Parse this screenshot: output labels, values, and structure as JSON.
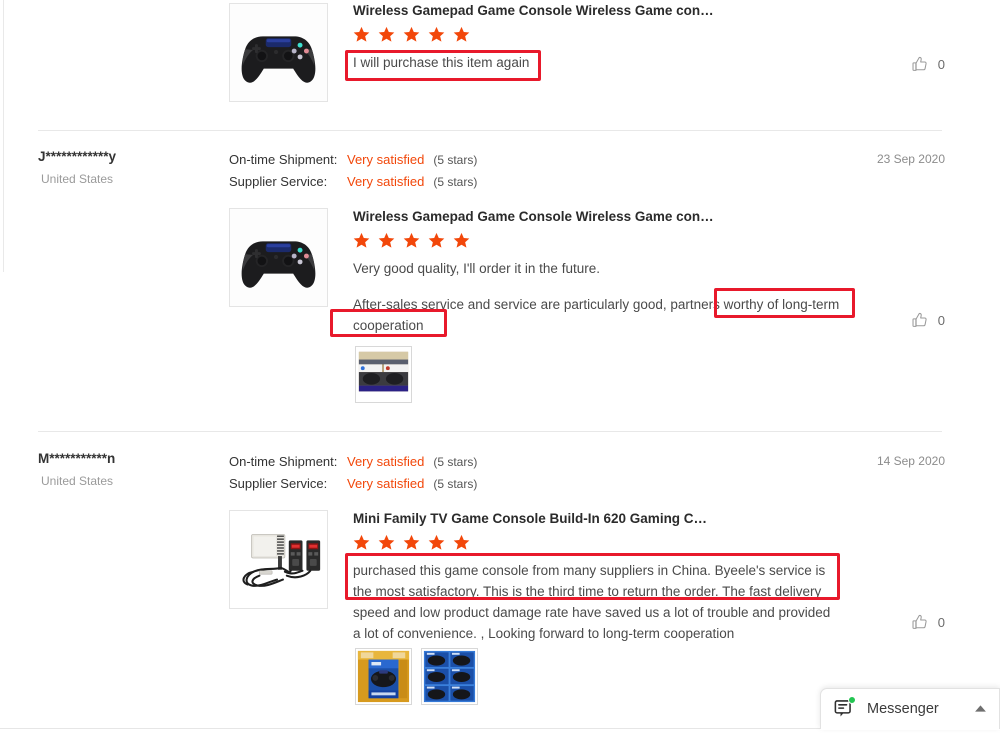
{
  "reviews": [
    {
      "id": "review-1",
      "reviewer": {
        "name": "",
        "country": ""
      },
      "date": "",
      "ratings": [],
      "product": {
        "title": "Wireless Gamepad Game Console Wireless Game con…",
        "stars": 5,
        "thumb_alt": "black-wireless-gamepad"
      },
      "paragraphs": [
        "I will purchase this item again"
      ],
      "photos": [],
      "like_count": "0"
    },
    {
      "id": "review-2",
      "reviewer": {
        "name": "J************y",
        "country": "United States"
      },
      "date": "23 Sep 2020",
      "ratings": [
        {
          "label": "On-time Shipment:",
          "value": "Very satisfied",
          "stars": "(5 stars)"
        },
        {
          "label": "Supplier Service:",
          "value": "Very satisfied",
          "stars": "(5 stars)"
        }
      ],
      "product": {
        "title": "Wireless Gamepad Game Console Wireless Game con…",
        "stars": 5,
        "thumb_alt": "black-wireless-gamepad"
      },
      "paragraphs": [
        "Very good quality, I'll order it in the future.",
        "After-sales service and service are particularly good, partners worthy of long-term cooperation"
      ],
      "photos": [
        "gamepad-packaging-photo"
      ],
      "like_count": "0"
    },
    {
      "id": "review-3",
      "reviewer": {
        "name": "M***********n",
        "country": "United States"
      },
      "date": "14 Sep 2020",
      "ratings": [
        {
          "label": "On-time Shipment:",
          "value": "Very satisfied",
          "stars": "(5 stars)"
        },
        {
          "label": "Supplier Service:",
          "value": "Very satisfied",
          "stars": "(5 stars)"
        }
      ],
      "product": {
        "title": "Mini Family TV Game Console Build-In 620 Gaming C…",
        "stars": 5,
        "thumb_alt": "mini-tv-game-console"
      },
      "paragraphs": [
        "purchased this game console from many suppliers in China. Byeele's service is the most satisfactory. This is the third time to return the order. The fast delivery speed and low product damage rate have saved us a lot of trouble and provided a lot of convenience. , Looking forward to long-term cooperation"
      ],
      "photos": [
        "gamepad-box-front-photo",
        "gamepad-boxes-stacked-photo"
      ],
      "like_count": "0"
    }
  ],
  "annotations": {
    "box1_text": "I will purchase this item again",
    "box2_text": "worthy of long-term",
    "box3_text": "cooperation",
    "box4_text": "purchased this game console from many suppliers in China. Byeele's service is the most satisfactory. This is the third time to return the order. The fast delivery spe"
  },
  "messenger": {
    "label": "Messenger",
    "status": "online",
    "caret": "▲"
  },
  "colors": {
    "star": "#f2470a",
    "rating_value": "#f2470a",
    "annotation": "#e8192b",
    "online_dot": "#23c552"
  },
  "icons": {
    "thumbs_up": "thumbs-up-icon",
    "messenger": "messenger-chat-icon",
    "star": "star-icon",
    "caret": "chevron-up-icon"
  }
}
